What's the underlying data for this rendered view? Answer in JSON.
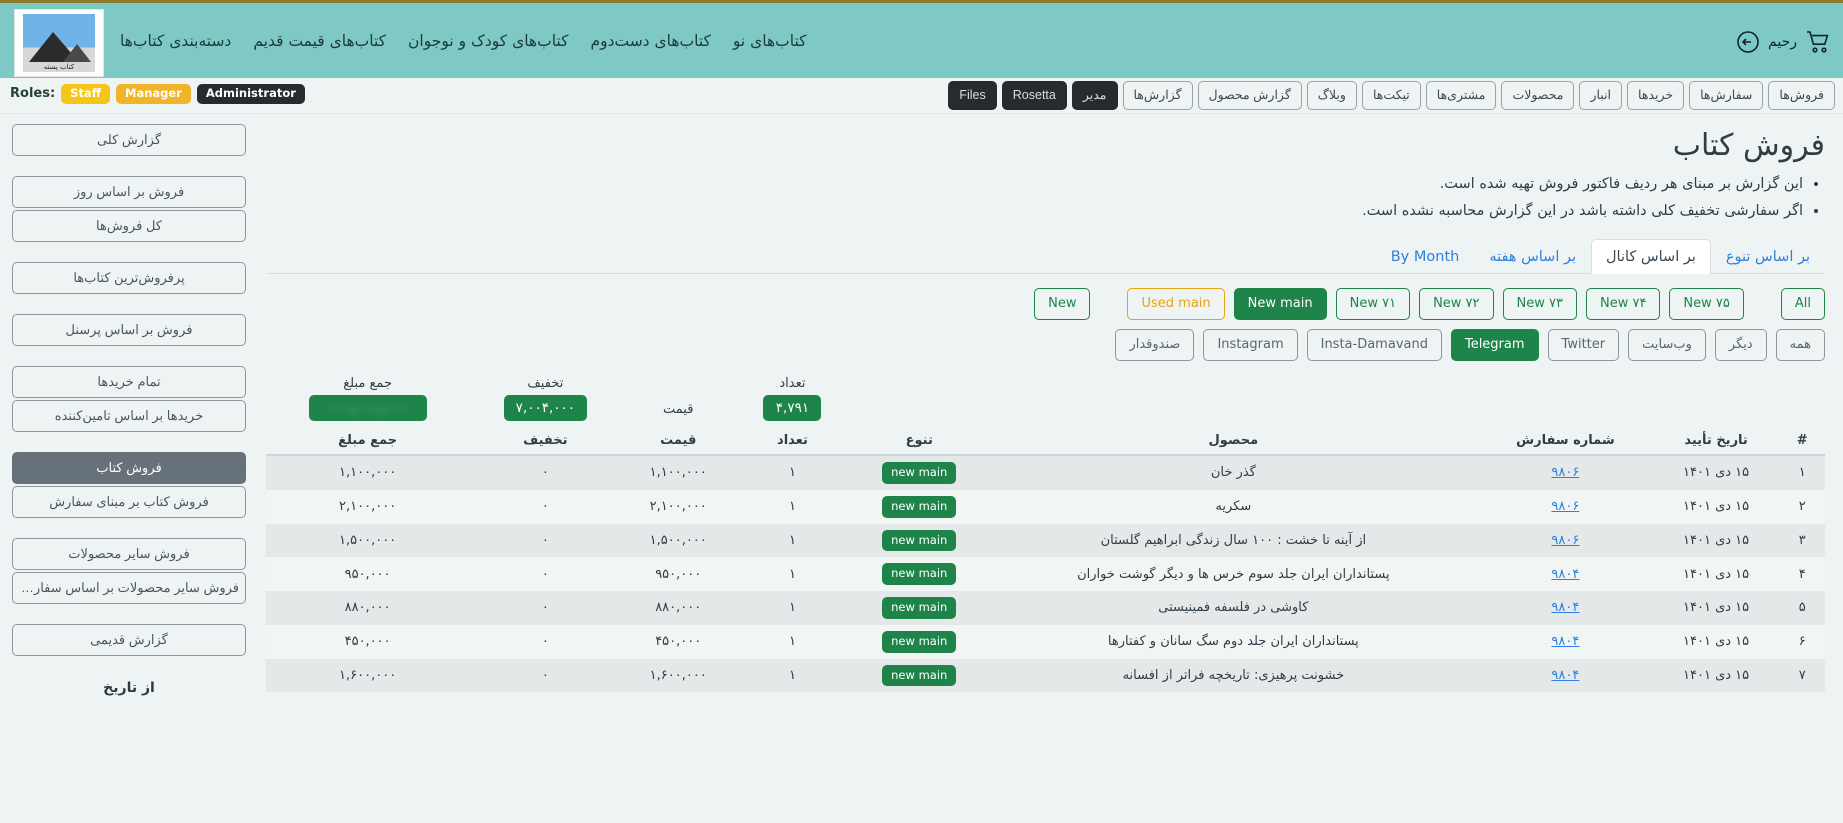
{
  "topnav": {
    "logo_caption": "کتاب پسته",
    "links": [
      "کتاب‌های نو",
      "کتاب‌های دست‌دوم",
      "کتاب‌های کودک و نوجوان",
      "کتاب‌های قیمت قدیم",
      "دسته‌بندی کتاب‌ها"
    ],
    "user_name": "رحیم",
    "cart_icon": "shopping-cart-icon",
    "logout_icon": "logout-icon"
  },
  "adminbar": {
    "roles_label": "Roles:",
    "roles": [
      {
        "label": "Staff",
        "style": "staff"
      },
      {
        "label": "Manager",
        "style": "manager"
      },
      {
        "label": "Administrator",
        "style": "admin"
      }
    ],
    "toolbar": [
      {
        "label": "فروش‌ها",
        "dark": false
      },
      {
        "label": "سفارش‌ها",
        "dark": false
      },
      {
        "label": "خریدها",
        "dark": false
      },
      {
        "label": "انبار",
        "dark": false
      },
      {
        "label": "محصولات",
        "dark": false
      },
      {
        "label": "مشتری‌ها",
        "dark": false
      },
      {
        "label": "تیکت‌ها",
        "dark": false
      },
      {
        "label": "وبلاگ",
        "dark": false
      },
      {
        "label": "گزارش محصول",
        "dark": false
      },
      {
        "label": "گزارش‌ها",
        "dark": false
      },
      {
        "label": "مدیر",
        "dark": true
      },
      {
        "label": "Rosetta",
        "dark": true
      },
      {
        "label": "Files",
        "dark": true
      }
    ]
  },
  "sidebar": {
    "groups": [
      {
        "items": [
          {
            "label": "گزارش کلی",
            "active": false
          }
        ]
      },
      {
        "items": [
          {
            "label": "فروش بر اساس روز",
            "active": false
          },
          {
            "label": "کل فروش‌ها",
            "active": false
          }
        ]
      },
      {
        "items": [
          {
            "label": "پرفروش‌ترین کتاب‌ها",
            "active": false
          }
        ]
      },
      {
        "items": [
          {
            "label": "فروش بر اساس پرسنل",
            "active": false
          }
        ]
      },
      {
        "items": [
          {
            "label": "تمام خریدها",
            "active": false
          },
          {
            "label": "خریدها بر اساس تامین‌کننده",
            "active": false
          }
        ]
      },
      {
        "items": [
          {
            "label": "فروش کتاب",
            "active": true
          },
          {
            "label": "فروش کتاب بر مبنای سفارش",
            "active": false
          }
        ]
      },
      {
        "items": [
          {
            "label": "فروش سایر محصولات",
            "active": false
          },
          {
            "label": "فروش سایر محصولات بر اساس سفارش",
            "active": false
          }
        ]
      },
      {
        "items": [
          {
            "label": "گزارش قدیمی",
            "active": false
          }
        ]
      }
    ],
    "date_label": "از تاریخ"
  },
  "main": {
    "title": "فروش کتاب",
    "notes": [
      "این گزارش بر مبنای هر ردیف فاکتور فروش تهیه شده است.",
      "اگر سفارشی تخفیف کلی داشته باشد در این گزارش محاسبه نشده است."
    ],
    "tabs": [
      {
        "label": "By Month",
        "active": false
      },
      {
        "label": "بر اساس هفته",
        "active": false
      },
      {
        "label": "بر اساس کانال",
        "active": true
      },
      {
        "label": "بر اساس تنوع",
        "active": false
      }
    ],
    "variant_filters": [
      {
        "label": "New",
        "style": "green-outline"
      },
      {
        "label": "Used main",
        "style": "amber-outline"
      },
      {
        "label": "New main",
        "style": "green-solid"
      },
      {
        "label": "New ۷۱",
        "style": "green-outline"
      },
      {
        "label": "New ۷۲",
        "style": "green-outline"
      },
      {
        "label": "New ۷۳",
        "style": "green-outline"
      },
      {
        "label": "New ۷۴",
        "style": "green-outline"
      },
      {
        "label": "New ۷۵",
        "style": "green-outline"
      },
      {
        "label": "All",
        "style": "green-outline"
      }
    ],
    "channel_filters": [
      {
        "label": "صندوقدار",
        "style": "plain"
      },
      {
        "label": "Instagram",
        "style": "plain"
      },
      {
        "label": "Insta-Damavand",
        "style": "plain"
      },
      {
        "label": "Telegram",
        "style": "green-solid"
      },
      {
        "label": "Twitter",
        "style": "plain"
      },
      {
        "label": "وب‌سایت",
        "style": "plain"
      },
      {
        "label": "دیگر",
        "style": "plain"
      },
      {
        "label": "همه",
        "style": "plain"
      }
    ]
  },
  "table": {
    "summary": {
      "count_label": "تعداد",
      "count_value": "۴,۷۹۱",
      "price_label": "قیمت",
      "discount_label": "تخفیف",
      "discount_value": "۷,۰۰۴,۰۰۰",
      "total_label": "جمع مبلغ",
      "total_value": "۰۰۰,۰۰۰,۰۰۰"
    },
    "columns": [
      "#",
      "تاریخ تأیید",
      "شماره سفارش",
      "محصول",
      "تنوع",
      "تعداد",
      "قیمت",
      "تخفیف",
      "جمع مبلغ"
    ],
    "rows": [
      {
        "index": "۱",
        "date": "۱۵ دی ۱۴۰۱",
        "order": "۹۸۰۶",
        "product": "گذر خان",
        "variant": "new main",
        "qty": "۱",
        "price": "۱,۱۰۰,۰۰۰",
        "discount": "۰",
        "total": "۱,۱۰۰,۰۰۰"
      },
      {
        "index": "۲",
        "date": "۱۵ دی ۱۴۰۱",
        "order": "۹۸۰۶",
        "product": "سکریه",
        "variant": "new main",
        "qty": "۱",
        "price": "۲,۱۰۰,۰۰۰",
        "discount": "۰",
        "total": "۲,۱۰۰,۰۰۰"
      },
      {
        "index": "۳",
        "date": "۱۵ دی ۱۴۰۱",
        "order": "۹۸۰۶",
        "product": "از آینه تا خشت : ۱۰۰ سال زندگی ابراهیم گلستان",
        "variant": "new main",
        "qty": "۱",
        "price": "۱,۵۰۰,۰۰۰",
        "discount": "۰",
        "total": "۱,۵۰۰,۰۰۰"
      },
      {
        "index": "۴",
        "date": "۱۵ دی ۱۴۰۱",
        "order": "۹۸۰۴",
        "product": "پستانداران ایران جلد سوم خرس ها و دیگر گوشت خواران",
        "variant": "new main",
        "qty": "۱",
        "price": "۹۵۰,۰۰۰",
        "discount": "۰",
        "total": "۹۵۰,۰۰۰"
      },
      {
        "index": "۵",
        "date": "۱۵ دی ۱۴۰۱",
        "order": "۹۸۰۴",
        "product": "کاوشی در فلسفه فمینیستی",
        "variant": "new main",
        "qty": "۱",
        "price": "۸۸۰,۰۰۰",
        "discount": "۰",
        "total": "۸۸۰,۰۰۰"
      },
      {
        "index": "۶",
        "date": "۱۵ دی ۱۴۰۱",
        "order": "۹۸۰۴",
        "product": "پستانداران ایران جلد دوم سگ سانان و کفتارها",
        "variant": "new main",
        "qty": "۱",
        "price": "۴۵۰,۰۰۰",
        "discount": "۰",
        "total": "۴۵۰,۰۰۰"
      },
      {
        "index": "۷",
        "date": "۱۵ دی ۱۴۰۱",
        "order": "۹۸۰۴",
        "product": "خشونت پرهیزی: تاریخچه فراتر از افسانه",
        "variant": "new main",
        "qty": "۱",
        "price": "۱,۶۰۰,۰۰۰",
        "discount": "۰",
        "total": "۱,۶۰۰,۰۰۰"
      }
    ]
  }
}
